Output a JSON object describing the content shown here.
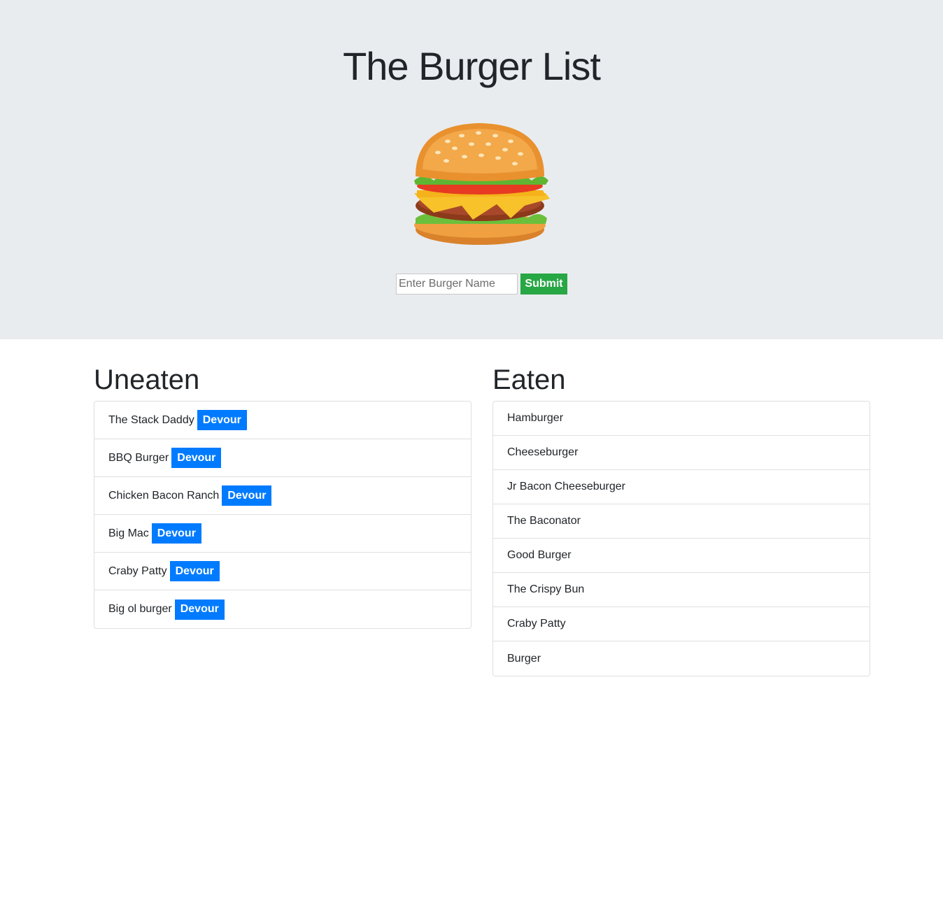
{
  "header": {
    "title": "The Burger List",
    "image_icon": "burger-image"
  },
  "form": {
    "input_placeholder": "Enter Burger Name",
    "input_value": "",
    "submit_label": "Submit",
    "submit_color": "#28a745"
  },
  "uneaten": {
    "heading": "Uneaten",
    "button_label": "Devour",
    "button_color": "#007bff",
    "items": [
      {
        "name": "The Stack Daddy"
      },
      {
        "name": "BBQ Burger"
      },
      {
        "name": "Chicken Bacon Ranch"
      },
      {
        "name": "Big Mac"
      },
      {
        "name": "Craby Patty"
      },
      {
        "name": "Big ol burger"
      }
    ]
  },
  "eaten": {
    "heading": "Eaten",
    "items": [
      {
        "name": "Hamburger"
      },
      {
        "name": "Cheeseburger"
      },
      {
        "name": "Jr Bacon Cheeseburger"
      },
      {
        "name": "The Baconator"
      },
      {
        "name": "Good Burger"
      },
      {
        "name": "The Crispy Bun"
      },
      {
        "name": "Craby Patty"
      },
      {
        "name": "Burger"
      }
    ]
  }
}
